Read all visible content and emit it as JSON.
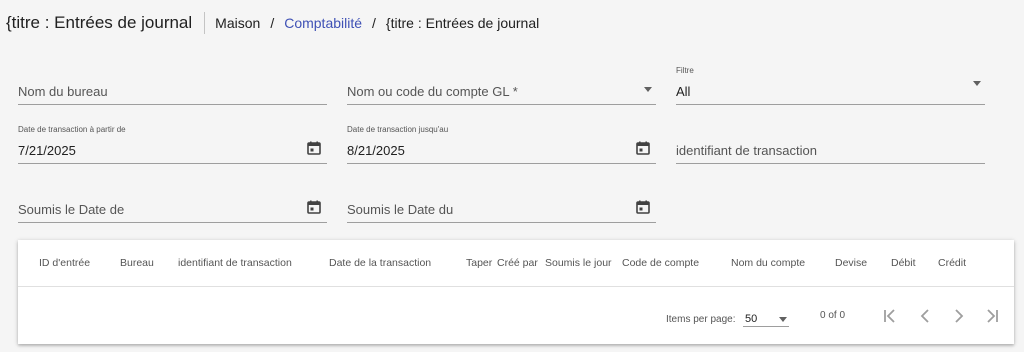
{
  "header": {
    "title": "{titre : Entrées de journal",
    "breadcrumb": {
      "home": "Maison",
      "sep1": "/",
      "accounting": "Comptabilité",
      "sep2": "/",
      "current": "{titre : Entrées de journal"
    }
  },
  "filters": {
    "office_name": {
      "placeholder": "Nom du bureau"
    },
    "gl_account": {
      "placeholder": "Nom ou code du compte GL *"
    },
    "filter": {
      "label": "Filtre",
      "value": "All"
    },
    "date_from": {
      "label": "Date de transaction à partir de",
      "value": "7/21/2025"
    },
    "date_to": {
      "label": "Date de transaction jusqu'au",
      "value": "8/21/2025"
    },
    "transaction_id": {
      "placeholder": "identifiant de transaction"
    },
    "submitted_from": {
      "placeholder": "Soumis le Date de"
    },
    "submitted_to": {
      "placeholder": "Soumis le Date du"
    }
  },
  "table": {
    "columns": [
      "ID d'entrée",
      "Bureau",
      "identifiant de transaction",
      "Date de la transaction",
      "Taper",
      "Créé par",
      "Soumis le jour",
      "Code de compte",
      "Nom du compte",
      "Devise",
      "Débit",
      "Crédit"
    ]
  },
  "paginator": {
    "items_per_page_label": "Items per page:",
    "page_size": "50",
    "range": "0 of 0"
  },
  "colors": {
    "accent": "#3f51b5",
    "background": "#f5f5f5",
    "card": "#ffffff"
  }
}
